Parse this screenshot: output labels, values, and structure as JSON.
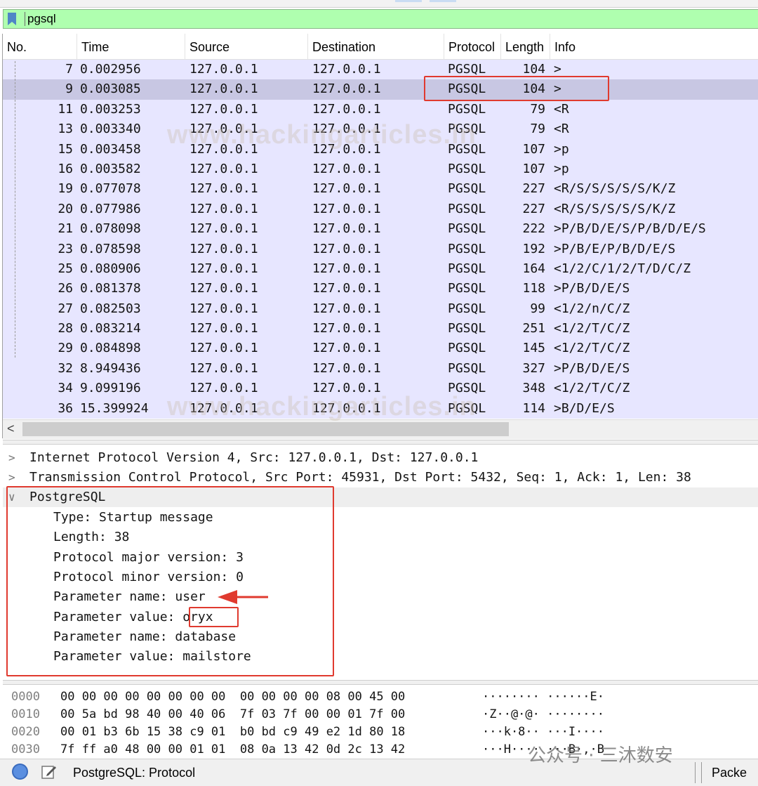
{
  "filter": {
    "value": "pgsql"
  },
  "columns": [
    "No.",
    "Time",
    "Source",
    "Destination",
    "Protocol",
    "Length",
    "Info"
  ],
  "packets": [
    {
      "no": "7",
      "time": "0.002956",
      "src": "127.0.0.1",
      "dst": "127.0.0.1",
      "proto": "PGSQL",
      "len": "104",
      "info": ">"
    },
    {
      "no": "9",
      "time": "0.003085",
      "src": "127.0.0.1",
      "dst": "127.0.0.1",
      "proto": "PGSQL",
      "len": "104",
      "info": ">"
    },
    {
      "no": "11",
      "time": "0.003253",
      "src": "127.0.0.1",
      "dst": "127.0.0.1",
      "proto": "PGSQL",
      "len": "79",
      "info": "<R"
    },
    {
      "no": "13",
      "time": "0.003340",
      "src": "127.0.0.1",
      "dst": "127.0.0.1",
      "proto": "PGSQL",
      "len": "79",
      "info": "<R"
    },
    {
      "no": "15",
      "time": "0.003458",
      "src": "127.0.0.1",
      "dst": "127.0.0.1",
      "proto": "PGSQL",
      "len": "107",
      "info": ">p"
    },
    {
      "no": "16",
      "time": "0.003582",
      "src": "127.0.0.1",
      "dst": "127.0.0.1",
      "proto": "PGSQL",
      "len": "107",
      "info": ">p"
    },
    {
      "no": "19",
      "time": "0.077078",
      "src": "127.0.0.1",
      "dst": "127.0.0.1",
      "proto": "PGSQL",
      "len": "227",
      "info": "<R/S/S/S/S/S/K/Z"
    },
    {
      "no": "20",
      "time": "0.077986",
      "src": "127.0.0.1",
      "dst": "127.0.0.1",
      "proto": "PGSQL",
      "len": "227",
      "info": "<R/S/S/S/S/S/K/Z"
    },
    {
      "no": "21",
      "time": "0.078098",
      "src": "127.0.0.1",
      "dst": "127.0.0.1",
      "proto": "PGSQL",
      "len": "222",
      "info": ">P/B/D/E/S/P/B/D/E/S"
    },
    {
      "no": "23",
      "time": "0.078598",
      "src": "127.0.0.1",
      "dst": "127.0.0.1",
      "proto": "PGSQL",
      "len": "192",
      "info": ">P/B/E/P/B/D/E/S"
    },
    {
      "no": "25",
      "time": "0.080906",
      "src": "127.0.0.1",
      "dst": "127.0.0.1",
      "proto": "PGSQL",
      "len": "164",
      "info": "<1/2/C/1/2/T/D/C/Z"
    },
    {
      "no": "26",
      "time": "0.081378",
      "src": "127.0.0.1",
      "dst": "127.0.0.1",
      "proto": "PGSQL",
      "len": "118",
      "info": ">P/B/D/E/S"
    },
    {
      "no": "27",
      "time": "0.082503",
      "src": "127.0.0.1",
      "dst": "127.0.0.1",
      "proto": "PGSQL",
      "len": "99",
      "info": "<1/2/n/C/Z"
    },
    {
      "no": "28",
      "time": "0.083214",
      "src": "127.0.0.1",
      "dst": "127.0.0.1",
      "proto": "PGSQL",
      "len": "251",
      "info": "<1/2/T/C/Z"
    },
    {
      "no": "29",
      "time": "0.084898",
      "src": "127.0.0.1",
      "dst": "127.0.0.1",
      "proto": "PGSQL",
      "len": "145",
      "info": "<1/2/T/C/Z"
    },
    {
      "no": "32",
      "time": "8.949436",
      "src": "127.0.0.1",
      "dst": "127.0.0.1",
      "proto": "PGSQL",
      "len": "327",
      "info": ">P/B/D/E/S"
    },
    {
      "no": "34",
      "time": "9.099196",
      "src": "127.0.0.1",
      "dst": "127.0.0.1",
      "proto": "PGSQL",
      "len": "348",
      "info": "<1/2/T/C/Z"
    },
    {
      "no": "36",
      "time": "15.399924",
      "src": "127.0.0.1",
      "dst": "127.0.0.1",
      "proto": "PGSQL",
      "len": "114",
      "info": ">B/D/E/S"
    }
  ],
  "selected_packet_index": 1,
  "details": {
    "ip": "Internet Protocol Version 4, Src: 127.0.0.1, Dst: 127.0.0.1",
    "tcp": "Transmission Control Protocol, Src Port: 45931, Dst Port: 5432, Seq: 1, Ack: 1, Len: 38",
    "pg": "PostgreSQL",
    "pg_fields": [
      "Type: Startup message",
      "Length: 38",
      "Protocol major version: 3",
      "Protocol minor version: 0",
      "Parameter name: user",
      "Parameter value: oryx",
      "Parameter name: database",
      "Parameter value: mailstore"
    ]
  },
  "bytes": [
    {
      "offset": "0000",
      "hex": "00 00 00 00 00 00 00 00  00 00 00 00 08 00 45 00",
      "ascii": "········ ······E·"
    },
    {
      "offset": "0010",
      "hex": "00 5a bd 98 40 00 40 06  7f 03 7f 00 00 01 7f 00",
      "ascii": "·Z··@·@· ········"
    },
    {
      "offset": "0020",
      "hex": "00 01 b3 6b 15 38 c9 01  b0 bd c9 49 e2 1d 80 18",
      "ascii": "···k·8·· ···I····"
    },
    {
      "offset": "0030",
      "hex": "7f ff a0 48 00 00 01 01  08 0a 13 42 0d 2c 13 42",
      "ascii": "···H···· ···B·,·B"
    }
  ],
  "status": {
    "text": "PostgreSQL: Protocol",
    "right_text": "Packe"
  },
  "watermark": {
    "top": "www.hackingarticles.in",
    "bottom": "www.hackingarticles.in",
    "wechat": "公众号 · 三沐数安"
  },
  "colors": {
    "filter_bg": "#afffaf",
    "row_bg": "#e7e6ff",
    "row_selected": "#c8c7e3",
    "annotation": "#e03a2f"
  }
}
